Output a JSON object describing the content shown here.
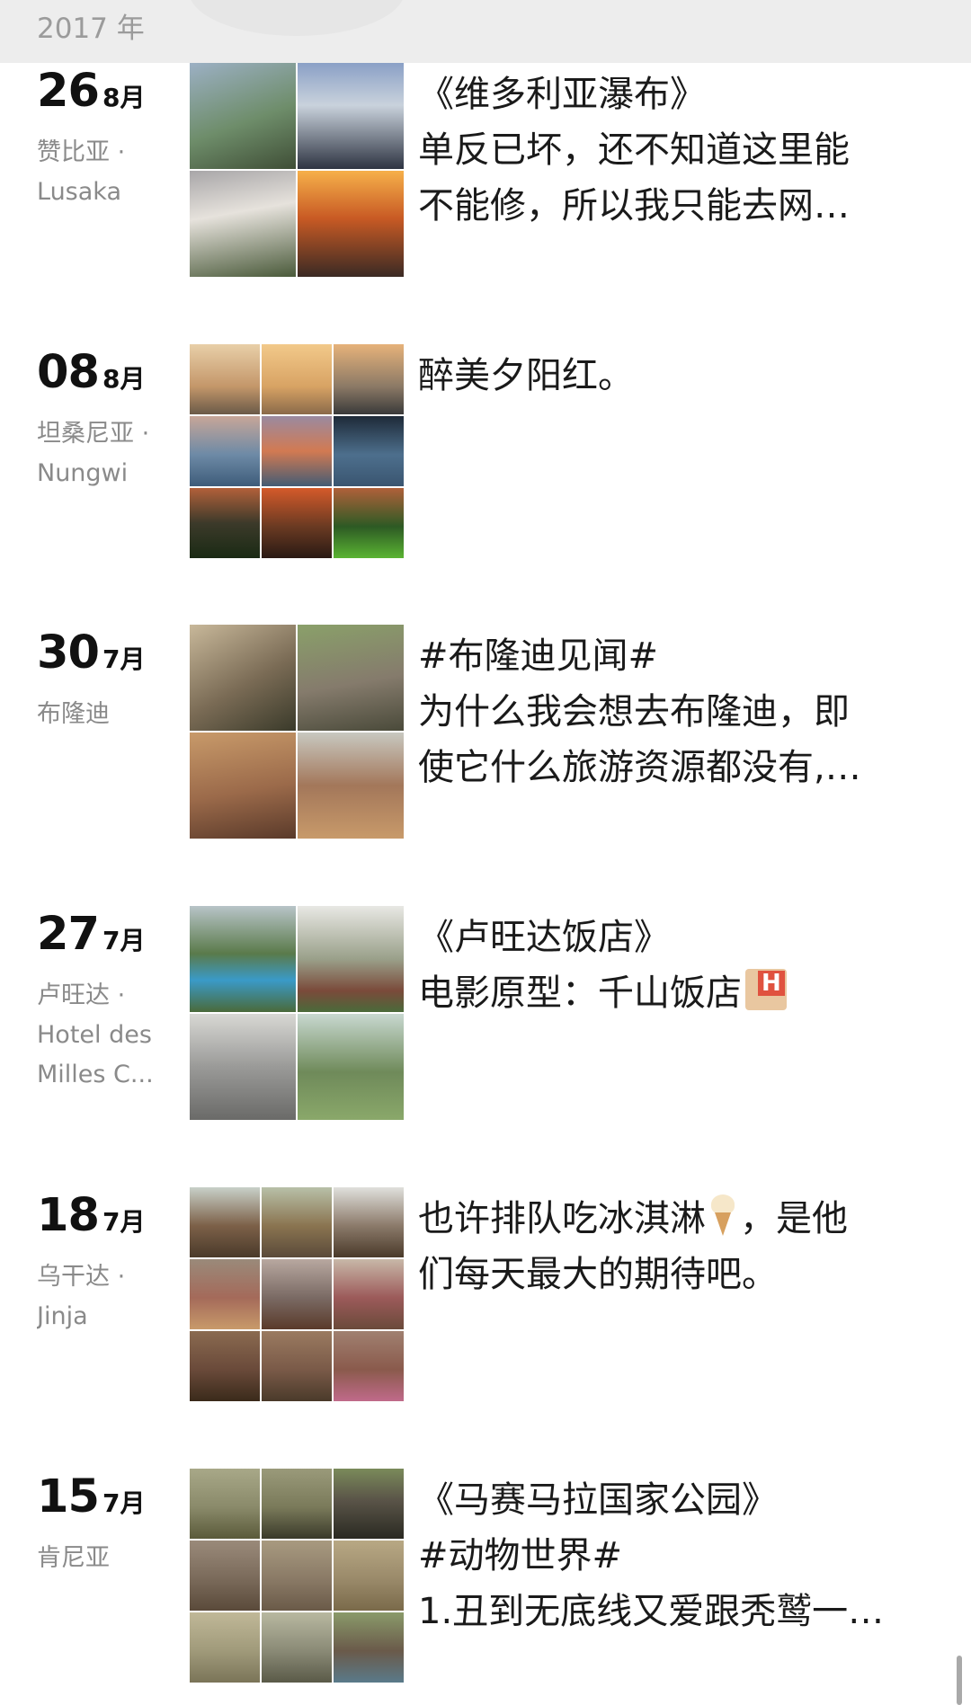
{
  "header": {
    "year": "2017 年"
  },
  "posts": [
    {
      "day": "26",
      "month": "8月",
      "location": [
        "赞比亚 ·",
        "Lusaka"
      ],
      "lines": [
        "《维多利亚瀑布》",
        "单反已坏，还不知道这里能",
        "不能修，所以我只能去网…"
      ],
      "emoji": "",
      "thumbs": [
        "#6e8d6a",
        "#586a88",
        "#8a7c76",
        "#b45a2c"
      ]
    },
    {
      "day": "08",
      "month": "8月",
      "location": [
        "坦桑尼亚 ·",
        " Nungwi"
      ],
      "lines": [
        "醉美夕阳红。"
      ],
      "emoji": "",
      "thumbs": [
        "#c4976a",
        "#d8a364",
        "#8c7a66",
        "#6d8aa6",
        "#b3907a",
        "#4d6f8d",
        "#1f2b1e",
        "#6a3a22",
        "#2d5a24"
      ]
    },
    {
      "day": "30",
      "month": "7月",
      "location": [
        "布隆迪"
      ],
      "lines": [
        "#布隆迪见闻#",
        "为什么我会想去布隆迪，即",
        "使它什么旅游资源都没有,…"
      ],
      "emoji": "",
      "thumbs": [
        "#7a6b55",
        "#857b6c",
        "#9b6a4a",
        "#a3775a"
      ]
    },
    {
      "day": "27",
      "month": "7月",
      "location": [
        "卢旺达 ·",
        "Hotel des",
        "Milles C..."
      ],
      "lines": [
        "《卢旺达饭店》",
        "电影原型：千山饭店"
      ],
      "emoji": "hotel-emoji",
      "thumbs": [
        "#6aa0b4",
        "#9aa08a",
        "#9a9a98",
        "#6f8a5a"
      ]
    },
    {
      "day": "18",
      "month": "7月",
      "location": [
        "乌干达 ·",
        "Jinja"
      ],
      "lines": [
        "也许排队吃冰淇淋",
        "，是他",
        "们每天最大的期待吧。"
      ],
      "emoji": "ice-cream-emoji",
      "thumbs": [
        "#7c6048",
        "#8a7450",
        "#8b7a6a",
        "#a46a5a",
        "#7a6a64",
        "#9c5a5a",
        "#6a4a3a",
        "#7a5a48",
        "#8a5a4c"
      ]
    },
    {
      "day": "15",
      "month": "7月",
      "location": [
        "肯尼亚"
      ],
      "lines": [
        "《马赛马拉国家公园》",
        "#动物世界#",
        "1.丑到无底线又爱跟秃鹫一…"
      ],
      "emoji": "",
      "thumbs": [
        "#8a8a6a",
        "#7a7a5a",
        "#5a5448",
        "#7a6a5a",
        "#8a7a66",
        "#9a8a6a",
        "#a09a7a",
        "#8a8a76",
        "#6a5a4a"
      ]
    }
  ]
}
